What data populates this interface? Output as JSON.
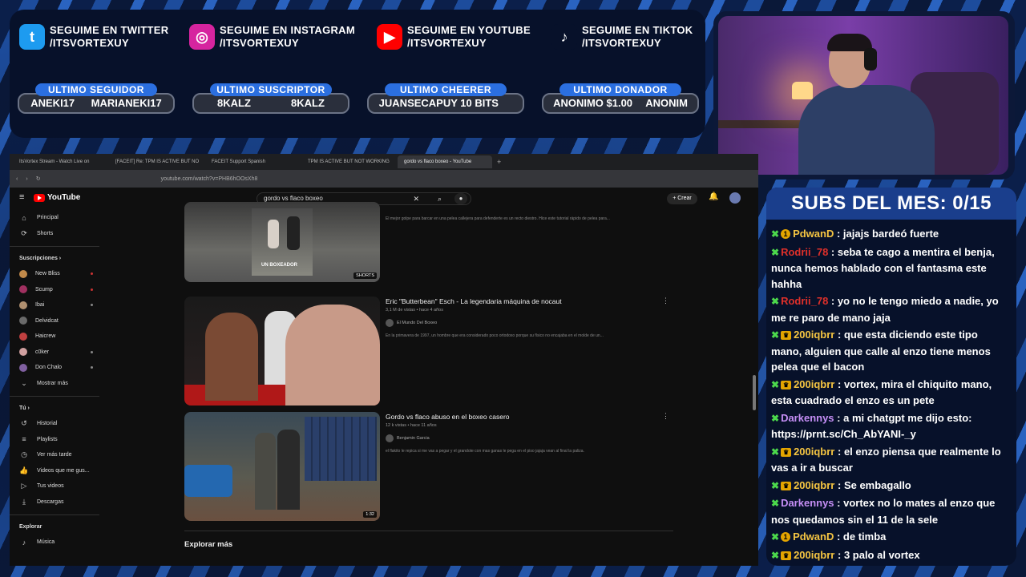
{
  "socials": [
    {
      "icon": "twitter-icon",
      "glyph": "t",
      "color": "#1d9bf0",
      "line1": "SEGUIME EN TWITTER",
      "line2": "/ITSVORTEXUY"
    },
    {
      "icon": "instagram-icon",
      "glyph": "◎",
      "color": "#d6249f",
      "line1": "SEGUIME EN INSTAGRAM",
      "line2": "/ITSVORTEXUY"
    },
    {
      "icon": "youtube-icon",
      "glyph": "▶",
      "color": "#ff0000",
      "line1": "SEGUIME EN YOUTUBE",
      "line2": "/ITSVORTEXUY"
    },
    {
      "icon": "tiktok-icon",
      "glyph": "♪",
      "color": "#07112a",
      "line1": "SEGUIME EN TIKTOK",
      "line2": "/ITSVORTEXUY"
    }
  ],
  "stats": [
    {
      "label": "ULTIMO SEGUIDOR",
      "value_a": "ANEKI17",
      "value_b": "MARIANEKI17"
    },
    {
      "label": "ULTIMO SUSCRIPTOR",
      "value_a": "8KALZ",
      "value_b": "8KALZ"
    },
    {
      "label": "ULTIMO CHEERER",
      "value_a": "JUANSECAPUY 10 BITS",
      "value_b": ""
    },
    {
      "label": "ULTIMO DONADOR",
      "value_a": "ANONIMO $1.00",
      "value_b": "ANONIM"
    }
  ],
  "browser": {
    "tabs": [
      "ItsVortex Stream - Watch Live on",
      "[FACEIT] Re: TPM IS ACTIVE BUT NO",
      "FACEIT Support Spanish",
      "TPM IS ACTIVE BUT NOT WORKING",
      "gordo vs flaco boxeo - YouTube"
    ],
    "active_tab": "gordo vs flaco boxeo - YouTube",
    "url": "youtube.com/watch?v=PHB6hOOsXh8"
  },
  "youtube": {
    "logo": "YouTube",
    "search_value": "gordo vs flaco boxeo",
    "create_label": "+ Crear",
    "sidebar": {
      "main": [
        {
          "icon": "home-icon",
          "glyph": "⌂",
          "label": "Principal"
        },
        {
          "icon": "shorts-icon",
          "glyph": "⟳",
          "label": "Shorts"
        }
      ],
      "subs_header": "Suscripciones  ›",
      "channels": [
        {
          "label": "New Bliss",
          "color": "#c28a4a",
          "dot": "red"
        },
        {
          "label": "Scump",
          "color": "#a03060",
          "dot": "red"
        },
        {
          "label": "Ibai",
          "color": "#b09070",
          "dot": "grey"
        },
        {
          "label": "Delvidcat",
          "color": "#6a6a6a",
          "dot": "none"
        },
        {
          "label": "Haicrew",
          "color": "#c04040",
          "dot": "none"
        },
        {
          "label": "c0ker",
          "color": "#d0a0a0",
          "dot": "grey"
        },
        {
          "label": "Don Chalo",
          "color": "#8060a0",
          "dot": "grey"
        }
      ],
      "more_label": "Mostrar más",
      "you_header": "Tú  ›",
      "you": [
        {
          "icon": "history-icon",
          "glyph": "↺",
          "label": "Historial"
        },
        {
          "icon": "playlists-icon",
          "glyph": "≡",
          "label": "Playlists"
        },
        {
          "icon": "watch-later-icon",
          "glyph": "◷",
          "label": "Ver más tarde"
        },
        {
          "icon": "liked-icon",
          "glyph": "👍",
          "label": "Videos que me gus..."
        },
        {
          "icon": "your-videos-icon",
          "glyph": "▷",
          "label": "Tus videos"
        },
        {
          "icon": "downloads-icon",
          "glyph": "⤓",
          "label": "Descargas"
        }
      ],
      "explore_header": "Explorar",
      "explore": [
        {
          "icon": "music-icon",
          "glyph": "♪",
          "label": "Música"
        }
      ]
    },
    "videos": [
      {
        "title": "",
        "meta": "",
        "channel": "",
        "desc": "El mejor golpe para barcar en una pelea callejera para defenderte es un recto diestro. Hice este tutorial rápido de pelea para...",
        "badge": "SHORTS",
        "overlay": "UN BOXEADOR"
      },
      {
        "title": "Eric \"Butterbean\" Esch - La legendaria máquina de nocaut",
        "meta": "3,1 M de vistas • hace 4 años",
        "channel": "El Mundo Del Boxeo",
        "desc": "En la primavera de 1997, un hombre que era considerado poco ortodoxo porque su físico no encajaba en el molde de un...",
        "badge": ""
      },
      {
        "title": "Gordo vs flaco abuso en el boxeo casero",
        "meta": "12 k vistas • hace 11 años",
        "channel": "Benjamin Garcia",
        "desc": "el flakito le repica si me vas a pegar y el grandote con mas ganas le pega en el piso jajaja vean al final la paliza.",
        "badge": "1:32"
      }
    ],
    "explore_more": "Explorar más"
  },
  "chat": {
    "header": "SUBS DEL MES: 0/15",
    "messages": [
      {
        "user": "PdwanD",
        "color": "#f5c542",
        "badge": "sub",
        "text": "jajajs bardeó fuerte"
      },
      {
        "user": "Rodrii_78",
        "color": "#e0302a",
        "badge": "none",
        "text": "seba te cago a mentira el benja, nunca hemos hablado con el fantasma este hahha"
      },
      {
        "user": "Rodrii_78",
        "color": "#e0302a",
        "badge": "none",
        "text": "yo no le tengo miedo a nadie, yo me re paro de mano jaja"
      },
      {
        "user": "200iqbrr",
        "color": "#f5c542",
        "badge": "crown",
        "text": "que esta diciendo este tipo mano, alguien que calle al enzo tiene menos pelea que el bacon"
      },
      {
        "user": "200iqbrr",
        "color": "#f5c542",
        "badge": "crown",
        "text": "vortex, mira el chiquito mano, esta cuadrado el enzo es un pete"
      },
      {
        "user": "Darkennys",
        "color": "#c58ef5",
        "badge": "none",
        "text": "a mi chatgpt me dijo esto: https://prnt.sc/Ch_AbYANI-_y"
      },
      {
        "user": "200iqbrr",
        "color": "#f5c542",
        "badge": "crown",
        "text": "el enzo piensa que realmente lo vas a ir a buscar"
      },
      {
        "user": "200iqbrr",
        "color": "#f5c542",
        "badge": "crown",
        "text": "Se embagallo"
      },
      {
        "user": "Darkennys",
        "color": "#c58ef5",
        "badge": "none",
        "text": "vortex no lo mates al enzo que nos quedamos sin el 11 de la sele"
      },
      {
        "user": "PdwanD",
        "color": "#f5c542",
        "badge": "sub",
        "text": "de timba"
      },
      {
        "user": "200iqbrr",
        "color": "#f5c542",
        "badge": "crown",
        "text": "3 palo al vortex"
      }
    ]
  }
}
